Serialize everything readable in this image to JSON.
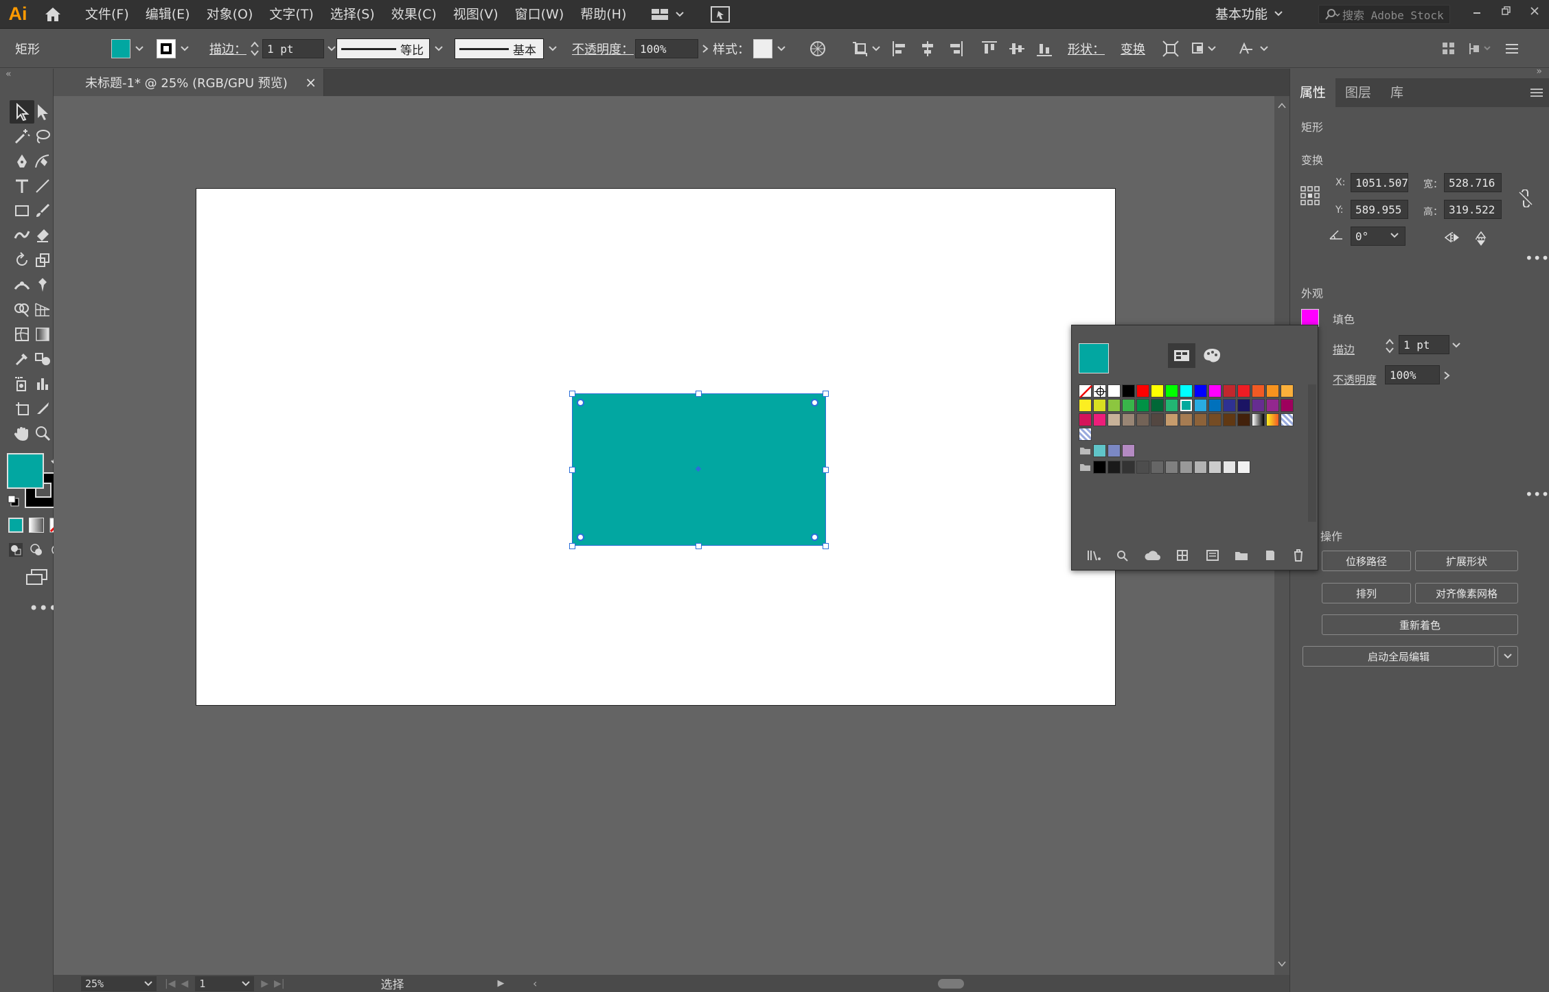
{
  "app": {
    "logo": "Ai",
    "menus": [
      "文件(F)",
      "编辑(E)",
      "对象(O)",
      "文字(T)",
      "选择(S)",
      "效果(C)",
      "视图(V)",
      "窗口(W)",
      "帮助(H)"
    ],
    "workspace": "基本功能",
    "search_placeholder": "搜索 Adobe Stock"
  },
  "control_bar": {
    "object_type": "矩形",
    "stroke_label": "描边：",
    "stroke_value": "1 pt",
    "stroke_profile": "等比",
    "brush": "基本",
    "opacity_label": "不透明度：",
    "opacity_value": "100%",
    "style_label": "样式：",
    "shape_label": "形状：",
    "transform_label": "变换"
  },
  "document": {
    "tab_title": "未标题-1* @ 25% (RGB/GPU 预览)",
    "zoom": "25%",
    "artboard_number": "1",
    "status_tool": "选择"
  },
  "colors": {
    "fill": "#02a7a1",
    "stroke": "#000000",
    "panel_fill_swatch": "#ff00ff",
    "selection": "#2b6ed8"
  },
  "properties_panel": {
    "tabs": [
      "属性",
      "图层",
      "库"
    ],
    "object_type": "矩形",
    "transform_title": "变换",
    "x_label": "X:",
    "x_value": "1051.507",
    "y_label": "Y:",
    "y_value": "589.955",
    "w_label": "宽：",
    "w_value": "528.716",
    "h_label": "高：",
    "h_value": "319.522",
    "angle_value": "0°",
    "appearance_title": "外观",
    "fill_label": "填色",
    "stroke_label": "描边",
    "stroke_value": "1 pt",
    "opacity_label": "不透明度",
    "opacity_value": "100%",
    "actions_title": "操作",
    "btn_offset_path": "位移路径",
    "btn_expand_shape": "扩展形状",
    "btn_arrange": "排列",
    "btn_pixel_grid": "对齐像素网格",
    "btn_recolor": "重新着色",
    "btn_global_edit": "启动全局编辑"
  },
  "swatches": {
    "current": "#02a7a1",
    "row1": [
      "none",
      "registration",
      "#ffffff",
      "#000000",
      "#ff0000",
      "#ffff00",
      "#00ff00",
      "#00ffff",
      "#0000ff",
      "#ff00ff",
      "#c1272d",
      "#ed1c24",
      "#f15a24",
      "#f7931e",
      "#fbb03b"
    ],
    "row2": [
      "#fcee21",
      "#d9e021",
      "#8cc63f",
      "#39b54a",
      "#009245",
      "#006837",
      "#22b573",
      "#00a99d",
      "#29abe2",
      "#0071bc",
      "#2e3192",
      "#1b1464",
      "#662d91",
      "#93278f",
      "#9e005d"
    ],
    "row3": [
      "#d4145a",
      "#ed1e79",
      "#c7b299",
      "#998675",
      "#736357",
      "#534741",
      "#c69c6d",
      "#a67c52",
      "#8c6239",
      "#754c24",
      "#603813",
      "#42210b",
      "gradient-bw",
      "gradient-orange",
      "pattern"
    ],
    "group1": [
      "#60c5c9",
      "#7b88c4",
      "#b48ac2"
    ],
    "grays": [
      "#000000",
      "#1a1a1a",
      "#333333",
      "#4d4d4d",
      "#666666",
      "#808080",
      "#999999",
      "#b3b3b3",
      "#cccccc",
      "#e6e6e6",
      "#f2f2f2"
    ]
  }
}
